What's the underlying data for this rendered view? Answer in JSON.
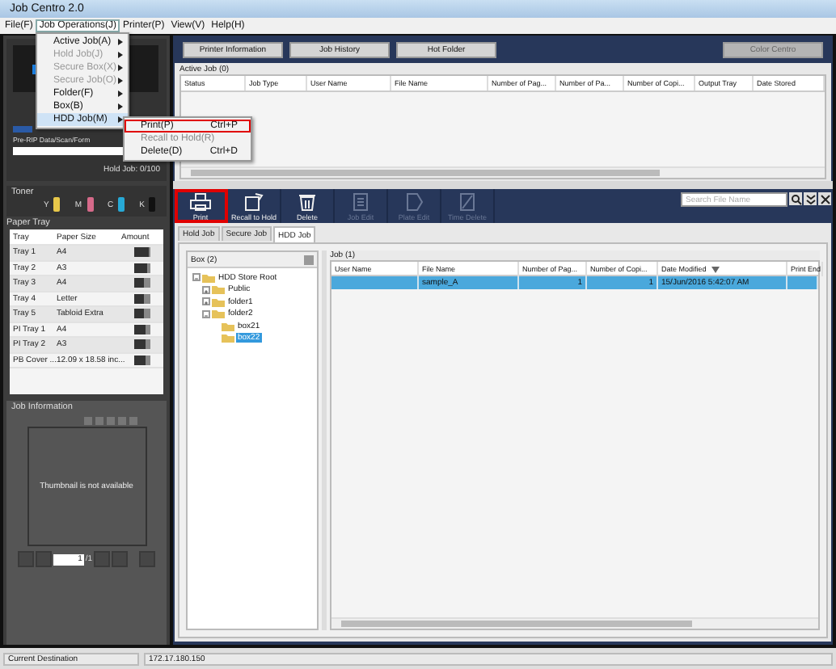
{
  "window": {
    "title": "Job Centro 2.0"
  },
  "menu_bar": [
    {
      "label": "File(F)",
      "selected": false
    },
    {
      "label": "Job Operations(J)",
      "selected": true
    },
    {
      "label": "Printer(P)",
      "selected": false
    },
    {
      "label": "View(V)",
      "selected": false
    },
    {
      "label": "Help(H)",
      "selected": false
    }
  ],
  "open_menu": [
    {
      "label": "Active Job(A)",
      "disabled": false,
      "submenu": true,
      "selected": false
    },
    {
      "label": "Hold Job(J)",
      "disabled": true,
      "submenu": true,
      "selected": false
    },
    {
      "label": "Secure Box(X)",
      "disabled": true,
      "submenu": true,
      "selected": false
    },
    {
      "label": "Secure Job(O)",
      "disabled": true,
      "submenu": true,
      "selected": false
    },
    {
      "label": "Folder(F)",
      "disabled": false,
      "submenu": true,
      "selected": false
    },
    {
      "label": "Box(B)",
      "disabled": false,
      "submenu": true,
      "selected": false
    },
    {
      "label": "HDD Job(M)",
      "disabled": false,
      "submenu": true,
      "selected": true
    }
  ],
  "submenu": [
    {
      "label": "Print(P)",
      "shortcut": "Ctrl+P",
      "disabled": false,
      "highlighted": true
    },
    {
      "label": "Recall to Hold(R)",
      "disabled": true,
      "highlighted": false
    },
    {
      "label": "Delete(D)",
      "shortcut": "Ctrl+D",
      "disabled": false,
      "highlighted": false
    }
  ],
  "printer_status": {
    "storage_label": "Pre-RIP Data/Scan/Form",
    "hold_job": "Hold Job: 0/100"
  },
  "toner": {
    "title": "Toner",
    "colors": [
      {
        "label": "Y",
        "color": "#e8c84a"
      },
      {
        "label": "M",
        "color": "#d66a8a"
      },
      {
        "label": "C",
        "color": "#27a9d6"
      },
      {
        "label": "K",
        "color": "#111111"
      }
    ]
  },
  "paper_tray": {
    "title": "Paper Tray",
    "columns": [
      "Tray",
      "Paper Size",
      "Amount"
    ],
    "rows": [
      {
        "tray": "Tray 1",
        "size": "A4",
        "level": 0.9
      },
      {
        "tray": "Tray 2",
        "size": "A3",
        "level": 0.8
      },
      {
        "tray": "Tray 3",
        "size": "A4",
        "level": 0.6
      },
      {
        "tray": "Tray 4",
        "size": "Letter",
        "level": 0.6
      },
      {
        "tray": "Tray 5",
        "size": "Tabloid Extra",
        "level": 0.6
      },
      {
        "tray": "PI Tray 1",
        "size": "A4",
        "level": 0.7
      },
      {
        "tray": "PI Tray 2",
        "size": "A3",
        "level": 0.7
      },
      {
        "tray": "PB Cover ...",
        "size": "12.09 x 18.58 inc...",
        "level": 0.7
      }
    ]
  },
  "job_information": {
    "title": "Job Information",
    "thumbnail_text": "Thumbnail is not available",
    "page": "1",
    "page_total": "/1"
  },
  "top_buttons": [
    {
      "label": "Printer Information",
      "disabled": false
    },
    {
      "label": "Job History",
      "disabled": false
    },
    {
      "label": "Hot Folder",
      "disabled": false
    },
    {
      "label": "Color Centro",
      "disabled": true
    }
  ],
  "active_job": {
    "title": "Active Job (0)",
    "columns": [
      "Status",
      "Job Type",
      "User Name",
      "File Name",
      "Number of Pag...",
      "Number of  Pa...",
      "Number of Copi...",
      "Output Tray",
      "Date Stored"
    ]
  },
  "toolbar": [
    {
      "label": "Print",
      "kind": "print",
      "disabled": false,
      "highlighted": true
    },
    {
      "label": "Recall to Hold",
      "kind": "recall",
      "disabled": false,
      "highlighted": false
    },
    {
      "label": "Delete",
      "kind": "delete",
      "disabled": false,
      "highlighted": false
    },
    {
      "label": "Job Edit",
      "kind": "edit",
      "disabled": true,
      "highlighted": false
    },
    {
      "label": "Plate Edit",
      "kind": "plate",
      "disabled": true,
      "highlighted": false
    },
    {
      "label": "Time Delete",
      "kind": "time",
      "disabled": true,
      "highlighted": false
    }
  ],
  "search": {
    "placeholder": "Search File Name"
  },
  "tabs": [
    {
      "label": "Hold Job",
      "selected": false
    },
    {
      "label": "Secure Job",
      "selected": false
    },
    {
      "label": "HDD Job",
      "selected": true
    }
  ],
  "box_tree": {
    "title": "Box (2)",
    "items": [
      {
        "label": "HDD Store Root",
        "expanded": true,
        "selected": false,
        "children": [
          {
            "label": "Public",
            "expanded": false,
            "selected": false
          },
          {
            "label": "folder1",
            "expanded": false,
            "selected": false
          },
          {
            "label": "folder2",
            "expanded": true,
            "selected": false,
            "children": [
              {
                "label": "box21",
                "selected": false
              },
              {
                "label": "box22",
                "selected": true
              }
            ]
          }
        ]
      }
    ]
  },
  "job_list": {
    "title": "Job (1)",
    "columns": [
      "User Name",
      "File Name",
      "Number of Pag...",
      "Number of Copi...",
      "Date Modified",
      "Print End"
    ],
    "rows": [
      {
        "selected": true,
        "cells": [
          "",
          "sample_A",
          "1",
          "1",
          "15/Jun/2016 5:42:07 AM",
          ""
        ]
      }
    ]
  },
  "status_bar": {
    "label": "Current Destination",
    "value": "172.17.180.150"
  }
}
